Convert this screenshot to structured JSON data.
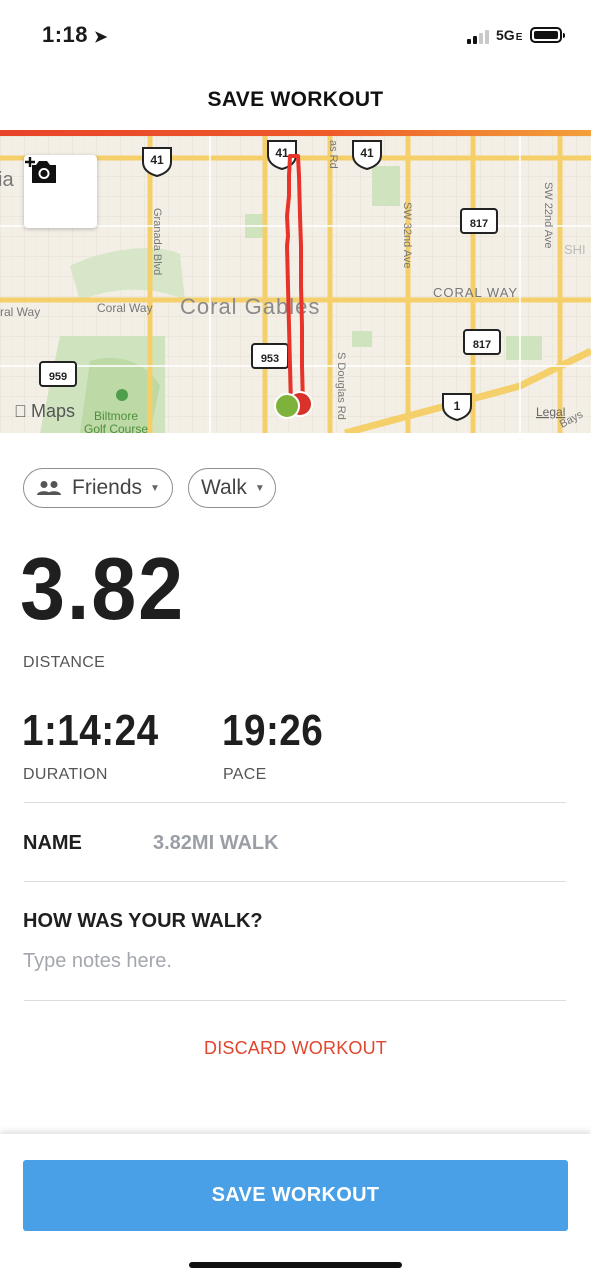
{
  "status_bar": {
    "time": "1:18",
    "network": "5G",
    "network_suffix": "E",
    "signal_bars": 2,
    "signal_bars_total": 4,
    "battery_level": 1.0
  },
  "header": {
    "title": "SAVE WORKOUT",
    "accent_colors": [
      "#e8432a",
      "#f2a03a"
    ]
  },
  "map": {
    "attribution": "Maps",
    "legal": "Legal",
    "labels": {
      "area": "Coral Gables",
      "coral_way_left": "ral Way",
      "coral_way": "Coral Way",
      "coral_way_right": "CORAL WAY",
      "granada": "Granada Blvd",
      "sw32": "SW 32nd Ave",
      "sw22": "SW 22nd Ave",
      "douglas": "S Douglas Rd",
      "douglas_top": "as Rd",
      "biltmore": "Biltmore",
      "golf": "Golf Course",
      "shi": "SHI",
      "ia": "ia",
      "bays": "Bays"
    },
    "shields": {
      "us41_a": "41",
      "us41_b": "41",
      "us41_c": "41",
      "us1": "1",
      "fl817_a": "817",
      "fl817_b": "817",
      "fl953": "953",
      "fl959": "959"
    },
    "route_color": "#e8332b",
    "start_color": "#7db33b",
    "end_color": "#d8322b"
  },
  "filters": {
    "visibility": "Friends",
    "activity": "Walk"
  },
  "stats": {
    "distance_value": "3.82",
    "distance_label": "DISTANCE",
    "duration_value": "1:14:24",
    "duration_label": "DURATION",
    "pace_value": "19:26",
    "pace_label": "PACE"
  },
  "form": {
    "name_label": "NAME",
    "name_value": "3.82MI WALK",
    "question": "HOW WAS YOUR WALK?",
    "notes_placeholder": "Type notes here.",
    "notes_value": ""
  },
  "actions": {
    "discard": "DISCARD WORKOUT",
    "save": "SAVE WORKOUT",
    "save_color": "#4aa0e6",
    "discard_color": "#e0452e"
  }
}
